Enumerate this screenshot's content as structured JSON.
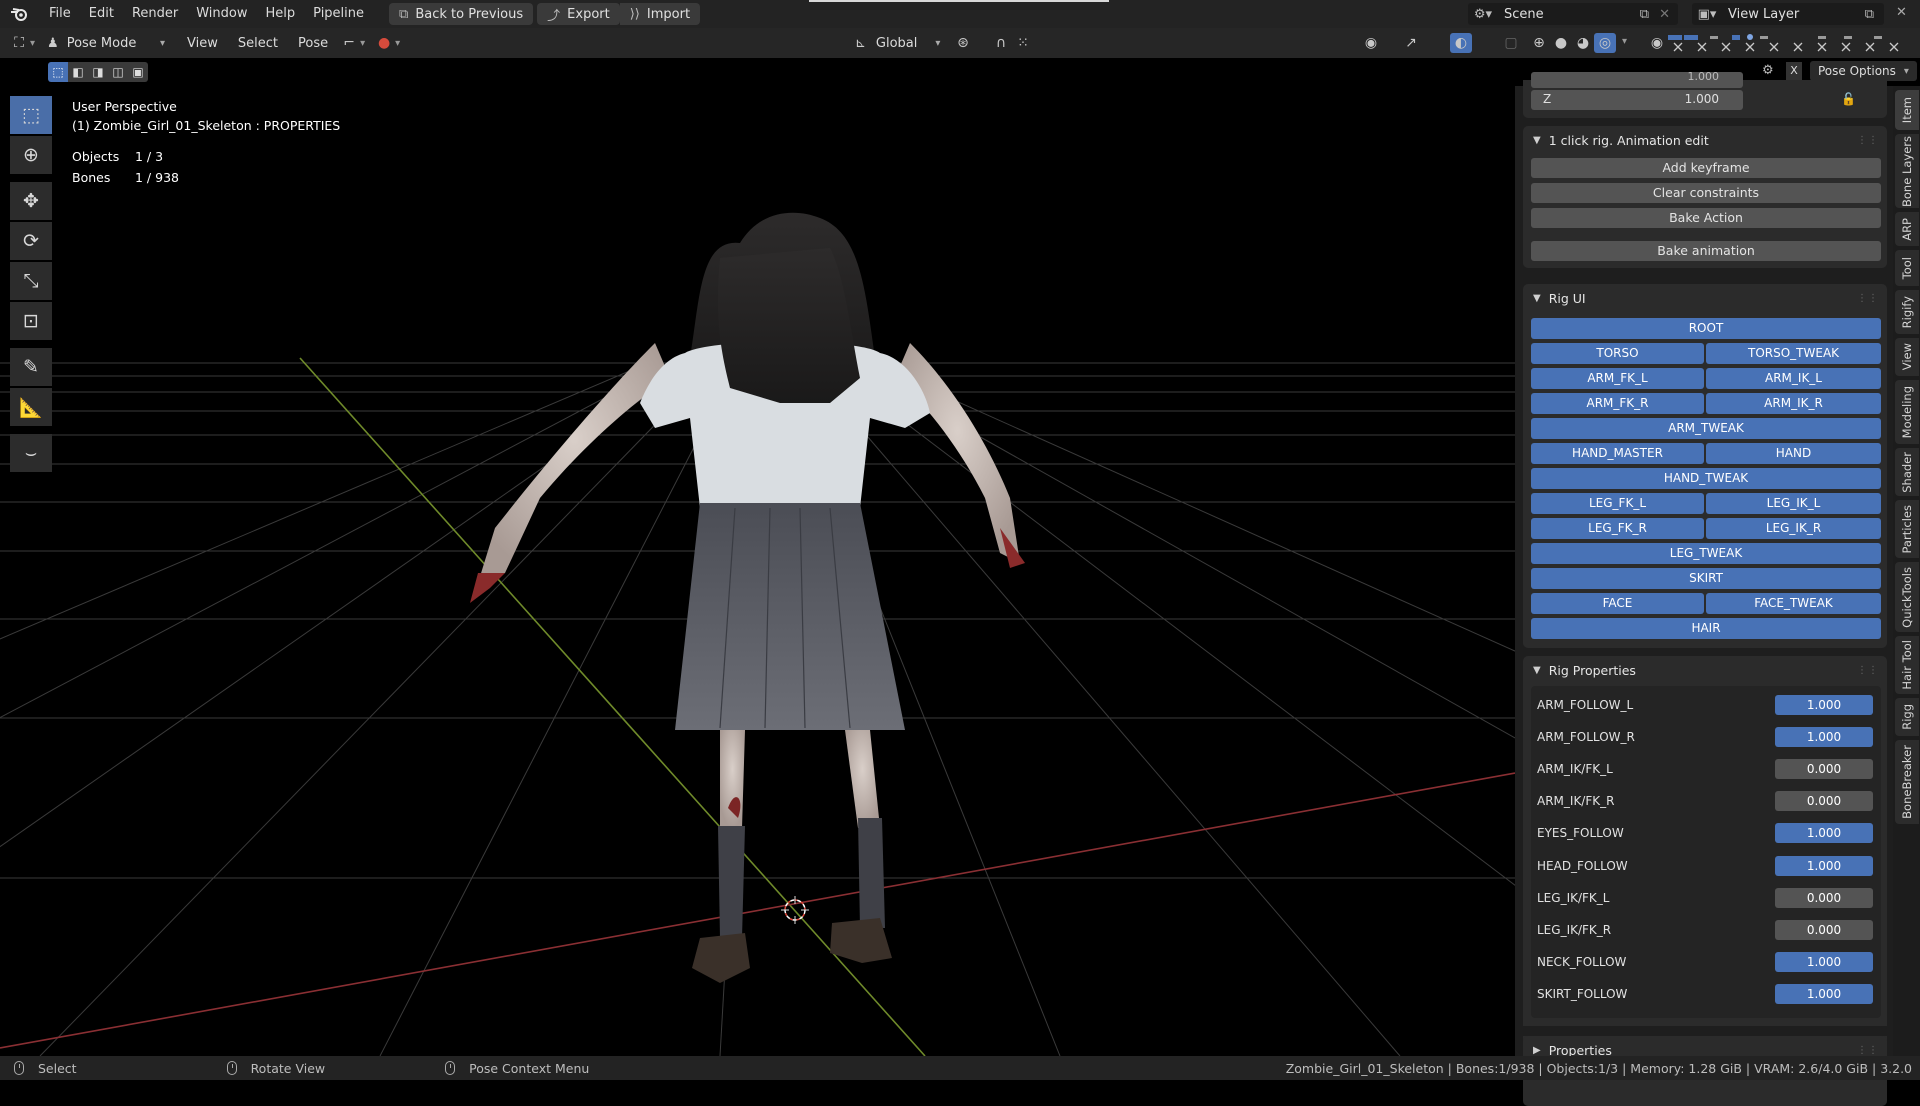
{
  "topbar": {
    "menus": [
      "File",
      "Edit",
      "Render",
      "Window",
      "Help",
      "Pipeline"
    ],
    "back_label": "Back to Previous",
    "export_label": "Export",
    "import_label": "Import",
    "scene": "Scene",
    "view_layer": "View Layer"
  },
  "header": {
    "mode": "Pose Mode",
    "menus": [
      "View",
      "Select",
      "Pose"
    ],
    "orientation": "Global",
    "pose_options": "Pose Options"
  },
  "viewport": {
    "perspective": "User Perspective",
    "active_object": "(1) Zombie_Girl_01_Skeleton : PROPERTIES",
    "objects_label": "Objects",
    "objects_value": "1 / 3",
    "bones_label": "Bones",
    "bones_value": "1 / 938"
  },
  "sidebar": {
    "transform": {
      "z_label": "Z",
      "z_value": "1.000",
      "partial_value": "1.000"
    },
    "animation_panel": {
      "title": "1 click rig. Animation edit",
      "buttons": [
        "Add keyframe",
        "Clear constraints",
        "Bake Action",
        "Bake animation"
      ]
    },
    "rig_ui": {
      "title": "Rig UI",
      "buttons": {
        "root": "ROOT",
        "torso": "TORSO",
        "torso_tweak": "TORSO_TWEAK",
        "arm_fk_l": "ARM_FK_L",
        "arm_ik_l": "ARM_IK_L",
        "arm_fk_r": "ARM_FK_R",
        "arm_ik_r": "ARM_IK_R",
        "arm_tweak": "ARM_TWEAK",
        "hand_master": "HAND_MASTER",
        "hand": "HAND",
        "hand_tweak": "HAND_TWEAK",
        "leg_fk_l": "LEG_FK_L",
        "leg_ik_l": "LEG_IK_L",
        "leg_fk_r": "LEG_FK_R",
        "leg_ik_r": "LEG_IK_R",
        "leg_tweak": "LEG_TWEAK",
        "skirt": "SKIRT",
        "face": "FACE",
        "face_tweak": "FACE_TWEAK",
        "hair": "HAIR"
      }
    },
    "rig_properties": {
      "title": "Rig Properties",
      "rows": [
        {
          "label": "ARM_FOLLOW_L",
          "value": "1.000"
        },
        {
          "label": "ARM_FOLLOW_R",
          "value": "1.000"
        },
        {
          "label": "ARM_IK/FK_L",
          "value": "0.000"
        },
        {
          "label": "ARM_IK/FK_R",
          "value": "0.000"
        },
        {
          "label": "EYES_FOLLOW",
          "value": "1.000"
        },
        {
          "label": "HEAD_FOLLOW",
          "value": "1.000"
        },
        {
          "label": "LEG_IK/FK_L",
          "value": "0.000"
        },
        {
          "label": "LEG_IK/FK_R",
          "value": "0.000"
        },
        {
          "label": "NECK_FOLLOW",
          "value": "1.000"
        },
        {
          "label": "SKIRT_FOLLOW",
          "value": "1.000"
        }
      ]
    },
    "properties_title": "Properties"
  },
  "right_tabs": [
    "Item",
    "Bone Layers",
    "ARP",
    "Tool",
    "Rigify",
    "View",
    "Modeling",
    "Shader",
    "Particles",
    "QuickTools",
    "Hair Tool",
    "Rigg",
    "BoneBreaker"
  ],
  "statusbar": {
    "select": "Select",
    "rotate": "Rotate View",
    "context": "Pose Context Menu",
    "info": "Zombie_Girl_01_Skeleton | Bones:1/938 | Objects:1/3 | Memory: 1.28 GiB | VRAM: 2.6/4.0 GiB | 3.2.0"
  },
  "colors": {
    "accent_blue": "#4872b6",
    "viewport_bg": "#000000",
    "panel_bg": "#2b2b2b",
    "x_axis": "#8a2f33",
    "y_axis": "#6f8a2a"
  }
}
